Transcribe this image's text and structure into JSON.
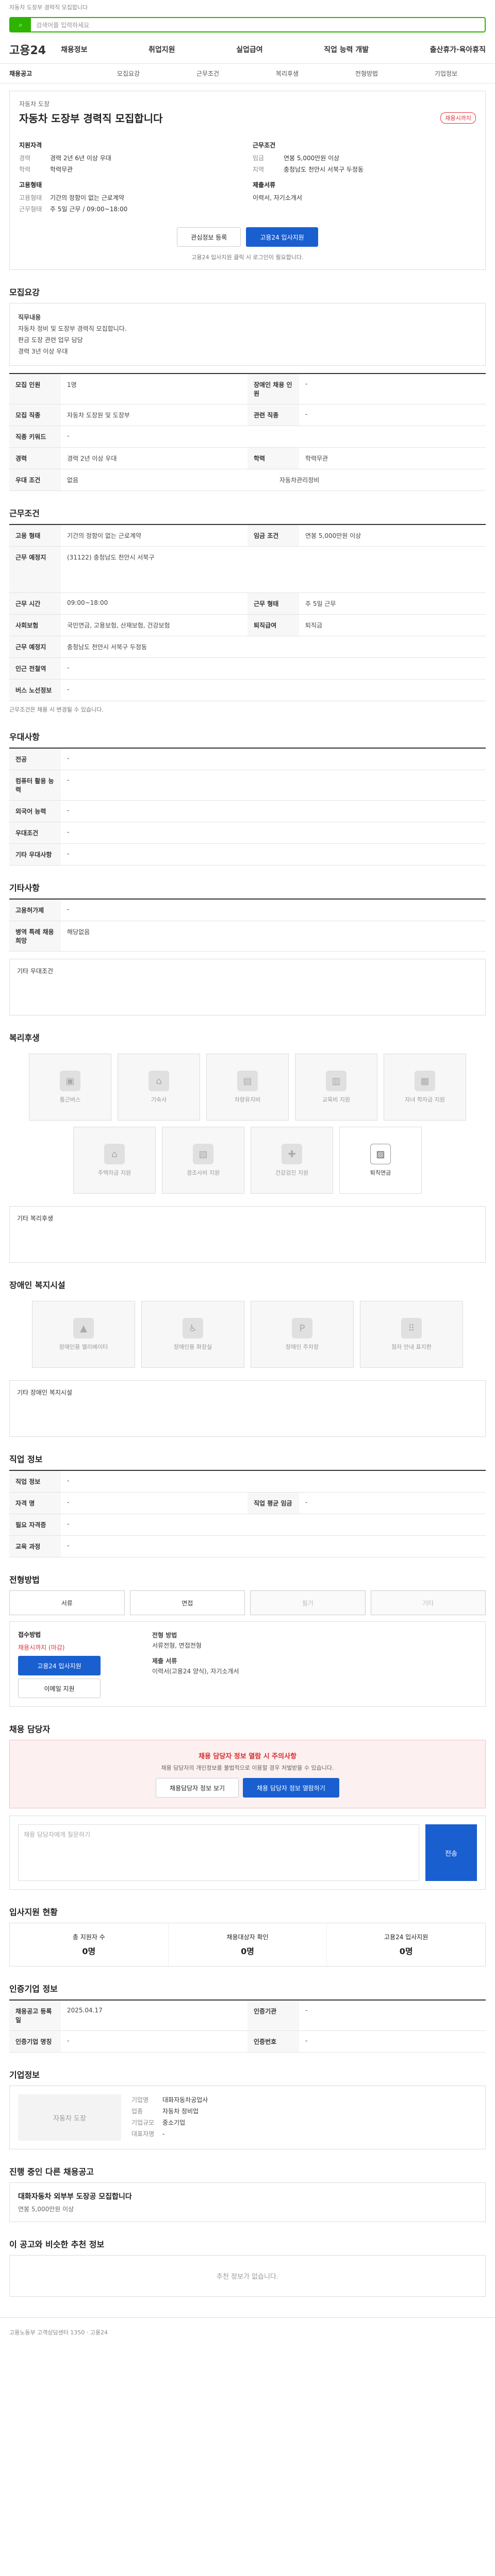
{
  "topbar": {
    "text": "자동차 도장부 경력직 모집합니다"
  },
  "search": {
    "placeholder": "검색어를 입력하세요",
    "btn": "검색"
  },
  "logo": "고용24",
  "gnb": [
    "채용정보",
    "취업지원",
    "실업급여",
    "직업 능력 개발",
    "출산휴가·육아휴직"
  ],
  "subnav": [
    "채용공고",
    "모집요강",
    "근무조건",
    "복리후생",
    "전형방법",
    "기업정보"
  ],
  "hero": {
    "company": "자동차 도장",
    "title": "자동차 도장부 경력직 모집합니다",
    "badge": "채용시까지",
    "left_h1": "지원자격",
    "edu_k": "경력",
    "edu_v": "경력 2년 6년 이상 우대",
    "lic_k": "학력",
    "lic_v": "학력무관",
    "left_h2": "고용형태",
    "emp_k1": "고용형태",
    "emp_v1": "기간의 정함이 없는 근로계약",
    "emp_k2": "근무형태",
    "emp_v2": "주 5일 근무 / 09:00~18:00",
    "right_h1": "근무조건",
    "pay_k": "임금",
    "pay_v": "연봉 5,000만원 이상",
    "loc_k": "지역",
    "loc_v": "충청남도 천안시 서북구 두정동",
    "right_h2": "제출서류",
    "doc_v": "이력서, 자기소개서",
    "btn1": "관심정보 등록",
    "btn2": "고용24 입사지원",
    "note": "고용24 입사지원 클릭 시 로그인이 필요합니다."
  },
  "recruit": {
    "h": "모집요강",
    "intro_h": "직무내용",
    "intro": [
      "자동차 정비 및 도장부 경력직 모집합니다.",
      "판금 도장 관련 업무 담당",
      "경력 3년 이상 우대"
    ],
    "rows": [
      [
        "모집 인원",
        "1명",
        "장애인 채용 인원",
        "-"
      ],
      [
        "모집 직종",
        "자동차 도장원 및 도장부",
        "관련 직종",
        "-"
      ],
      [
        "직종 키워드",
        "-",
        "",
        ""
      ],
      [
        "경력",
        "경력 2년 이상 우대",
        "학력",
        "학력무관"
      ],
      [
        "우대 조건",
        "없음",
        "자동차관리정비",
        ""
      ]
    ]
  },
  "work": {
    "h": "근무조건",
    "rows": [
      [
        "고용 형태",
        "기간의 정함이 없는 근로계약",
        "임금 조건",
        "연봉 5,000만원 이상"
      ],
      [
        "근무 예정지",
        "(31122) 충청남도 천안시 서북구",
        "",
        ""
      ],
      [
        "근무 시간",
        "09:00~18:00",
        "근무 형태",
        "주 5일 근무"
      ],
      [
        "사회보험",
        "국민연금, 고용보험, 산재보험, 건강보험",
        "퇴직급여",
        "퇴직금"
      ],
      [
        "근무 예정지",
        "충청남도 천안시 서북구 두정동",
        "",
        ""
      ],
      [
        "인근 전철역",
        "-",
        "",
        ""
      ],
      [
        "버스 노선정보",
        "-",
        "",
        ""
      ]
    ],
    "note": "근무조건은 채용 시 변경될 수 있습니다."
  },
  "prefer": {
    "h": "우대사항",
    "rows": [
      [
        "전공",
        "-"
      ],
      [
        "컴퓨터 활용 능력",
        "-"
      ],
      [
        "외국어 능력",
        "-"
      ],
      [
        "우대조건",
        "-"
      ],
      [
        "기타 우대사항",
        "-"
      ]
    ]
  },
  "etc": {
    "h": "기타사항",
    "rows": [
      [
        "고용허가제",
        "-"
      ],
      [
        "병역 특례 채용 희망",
        "해당없음"
      ]
    ],
    "box": "기타 우대조건"
  },
  "welfare": {
    "h": "복리후생",
    "items": [
      "통근버스",
      "기숙사",
      "차량유지비",
      "교육비 지원",
      "자녀 학자금 지원",
      "주택자금 지원",
      "경조사비 지원",
      "건강검진 지원",
      "퇴직연금"
    ],
    "boxh": "기타 복리후생"
  },
  "disabled": {
    "h": "장애인 복지시설",
    "items": [
      "장애인용 엘리베이터",
      "장애인용 화장실",
      "장애인 주차장",
      "점자 안내 표지판"
    ],
    "boxh": "기타 장애인 복지시설"
  },
  "jobinfo": {
    "h": "직업 정보",
    "rows": [
      [
        "직업 정보",
        "-",
        "",
        ""
      ],
      [
        "자격 명",
        "-",
        "직업 평균 임금",
        "-"
      ],
      [
        "필요 자격증",
        "-",
        "",
        ""
      ],
      [
        "교육 과정",
        "-",
        "",
        ""
      ]
    ]
  },
  "select": {
    "h": "전형방법",
    "tabs": [
      "서류",
      "면접",
      "필기",
      "기타"
    ],
    "apply_h": "접수방법",
    "apply_v": "고용24 입사지원",
    "apply_sub": "이메일 지원",
    "deadline": "채용시까지 (마감)",
    "right_h": "전형 방법",
    "right_v": "서류전형, 면접전형",
    "docs_h": "제출 서류",
    "docs_v": "이력서(고용24 양식), 자기소개서"
  },
  "qna": {
    "h": "채용 담당자",
    "alert": "채용 담당자 정보 열람 시 주의사항",
    "alert_sub": "채용 담당자의 개인정보를 불법적으로 이용할 경우 처벌받을 수 있습니다.",
    "btn1": "채용담당자 정보 보기",
    "btn2": "채용 담당자 정보 열람하기",
    "ta": "채용 담당자에게 질문하기",
    "go": "전송"
  },
  "status": {
    "h": "입사지원 현황",
    "c1": "총 지원자 수",
    "n1": "0명",
    "c2": "채용대상자 확인",
    "n2": "0명",
    "c3": "고용24 입사지원",
    "n3": "0명"
  },
  "info": {
    "h": "인증기업 정보",
    "rows": [
      [
        "채용공고 등록일",
        "2025.04.17",
        "인증기관",
        "-"
      ],
      [
        "인증기업 명칭",
        "-",
        "인증번호",
        "-"
      ]
    ]
  },
  "company": {
    "h": "기업정보",
    "name": "자동차 도장",
    "rows": [
      [
        "기업명",
        "대화자동차공업사"
      ],
      [
        "업종",
        "자동차 정비업"
      ],
      [
        "기업규모",
        "중소기업"
      ],
      [
        "대표자명",
        "-"
      ]
    ]
  },
  "other": {
    "h": "진행 중인 다른 채용공고",
    "title": "대화자동차 외부부 도장공 모집합니다",
    "pay": "연봉 5,000만원 이상"
  },
  "recommend": {
    "h": "이 공고와 비슷한 추천 정보",
    "empty": "추천 정보가 없습니다."
  },
  "footer": {
    "text": "고용노동부 고객상담센터 1350 · 고용24"
  }
}
